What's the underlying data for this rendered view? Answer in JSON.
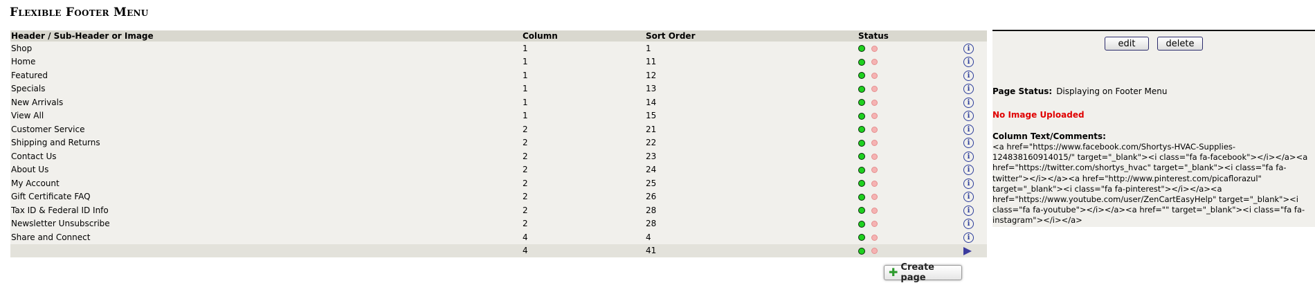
{
  "page_title": "Flexible Footer Menu",
  "table": {
    "headers": {
      "name": "Header / Sub-Header or Image",
      "column": "Column",
      "sort_order": "Sort Order",
      "status": "Status"
    },
    "rows": [
      {
        "name": "Shop",
        "column": "1",
        "sort": "1"
      },
      {
        "name": "Home",
        "column": "1",
        "sort": "11"
      },
      {
        "name": "Featured",
        "column": "1",
        "sort": "12"
      },
      {
        "name": "Specials",
        "column": "1",
        "sort": "13"
      },
      {
        "name": "New Arrivals",
        "column": "1",
        "sort": "14"
      },
      {
        "name": "View All",
        "column": "1",
        "sort": "15"
      },
      {
        "name": "Customer Service",
        "column": "2",
        "sort": "21"
      },
      {
        "name": "Shipping and Returns",
        "column": "2",
        "sort": "22"
      },
      {
        "name": "Contact Us",
        "column": "2",
        "sort": "23"
      },
      {
        "name": "About Us",
        "column": "2",
        "sort": "24"
      },
      {
        "name": "My Account",
        "column": "2",
        "sort": "25"
      },
      {
        "name": "Gift Certificate FAQ",
        "column": "2",
        "sort": "26"
      },
      {
        "name": "Tax ID & Federal ID Info",
        "column": "2",
        "sort": "28"
      },
      {
        "name": "Newsletter Unsubscribe",
        "column": "2",
        "sort": "28"
      },
      {
        "name": "Share and Connect",
        "column": "4",
        "sort": "4"
      },
      {
        "name": "",
        "column": "4",
        "sort": "41",
        "selected": true
      }
    ]
  },
  "create_page_label": "Create page",
  "panel": {
    "edit_label": "edit",
    "delete_label": "delete",
    "page_status_label": "Page Status:",
    "page_status_value": "Displaying on Footer Menu",
    "no_image": "No Image Uploaded",
    "comments_label": "Column Text/Comments:",
    "comments_text": "<a href=\"https://www.facebook.com/Shortys-HVAC-Supplies-124838160914015/\" target=\"_blank\"><i class=\"fa fa-facebook\"></i></a><a href=\"https://twitter.com/shortys_hvac\" target=\"_blank\"><i class=\"fa fa-twitter\"></i></a><a href=\"http://www.pinterest.com/picaflorazul\" target=\"_blank\"><i class=\"fa fa-pinterest\"></i></a><a href=\"https://www.youtube.com/user/ZenCartEasyHelp\" target=\"_blank\"><i class=\"fa fa-youtube\"></i></a><a href=\"\" target=\"_blank\"><i class=\"fa fa-instagram\"></i></a>"
  },
  "colors": {
    "status_active": "#1fd11f",
    "status_inactive": "#f5b3b3",
    "error_text": "#e00000",
    "header_bg": "#d9d8cf",
    "row_bg": "#f1f0ec"
  },
  "icons": {
    "row_action": "info-icon",
    "selected_row_action": "arrow-right-icon",
    "create": "plus-icon"
  }
}
